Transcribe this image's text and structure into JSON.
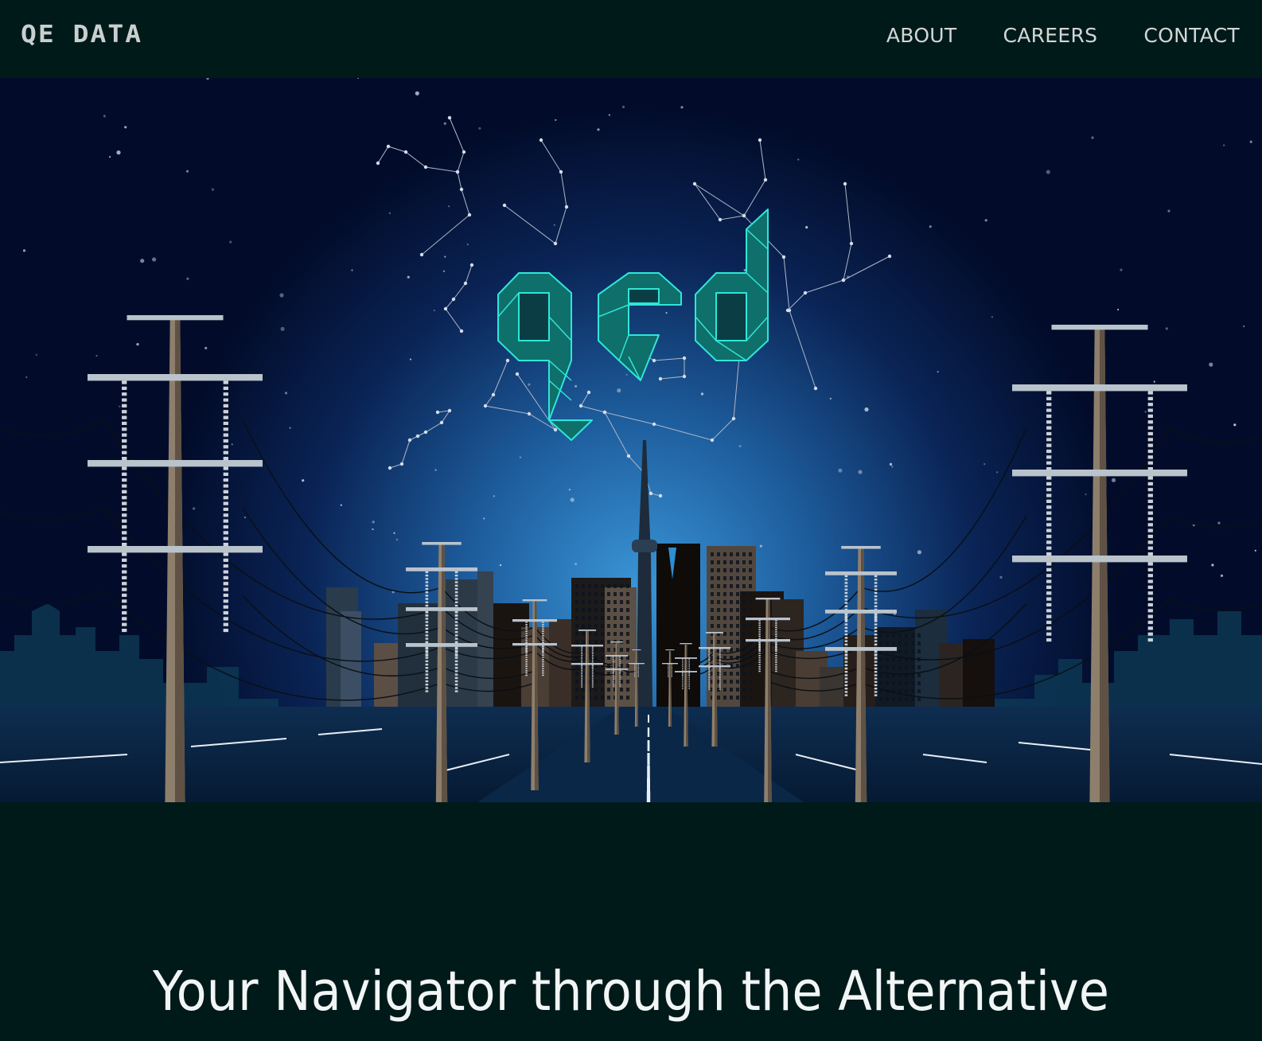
{
  "header": {
    "logo": "QE DATA",
    "nav": [
      {
        "label": "ABOUT"
      },
      {
        "label": "CAREERS"
      },
      {
        "label": "CONTACT"
      }
    ]
  },
  "hero": {
    "illustration": "night-city-powerlines",
    "wordmark": "qed",
    "colors": {
      "sky": "#020c2a",
      "glow": "#2f86c9",
      "wordmark": "#2ee6d8",
      "wordmark_fill": "#0f6f6a"
    }
  },
  "main": {
    "tagline": "Your Navigator through the Alternative"
  }
}
